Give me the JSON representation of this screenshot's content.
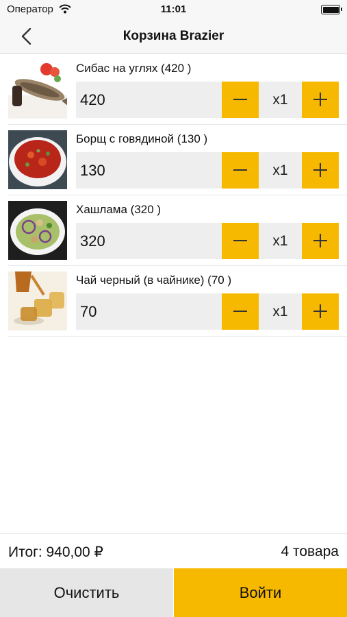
{
  "status_bar": {
    "carrier": "Оператор",
    "time": "11:01"
  },
  "header": {
    "title": "Корзина Brazier"
  },
  "cart": {
    "items": [
      {
        "name": "Сибас на углях (420 )",
        "price": "420",
        "quantity": "x1"
      },
      {
        "name": "Борщ с говядиной (130 )",
        "price": "130",
        "quantity": "x1"
      },
      {
        "name": "Хашлама (320 )",
        "price": "320",
        "quantity": "x1"
      },
      {
        "name": "Чай черный (в чайнике) (70 )",
        "price": "70",
        "quantity": "x1"
      }
    ]
  },
  "footer": {
    "total": "Итог: 940,00 ₽",
    "count": "4 товара",
    "clear_label": "Очистить",
    "login_label": "Войти"
  },
  "colors": {
    "accent": "#f7b900",
    "field": "#eeeeee",
    "clear_button": "#e6e6e6"
  }
}
